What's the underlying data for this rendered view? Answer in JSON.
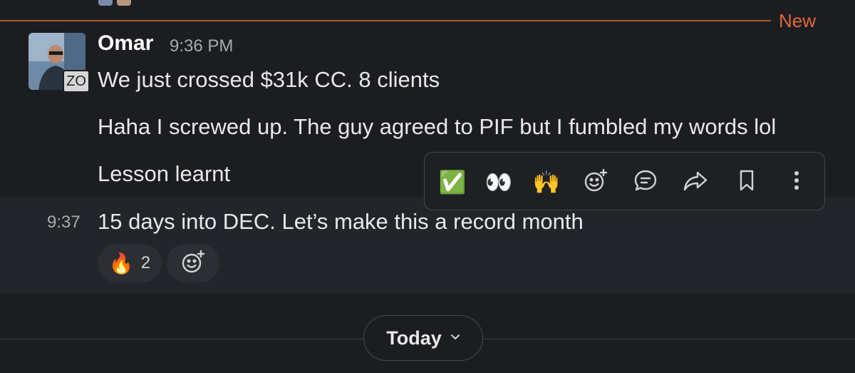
{
  "divider": {
    "label": "New"
  },
  "message_group": {
    "sender": "Omar",
    "time": "9:36 PM",
    "avatar_badge": "ZO",
    "messages": [
      "We just crossed $31k CC. 8 clients",
      "Haha I screwed up. The guy agreed to PIF but I fumbled my words lol",
      "Lesson learnt"
    ]
  },
  "hovered_message": {
    "time": "9:37",
    "text": "15 days into DEC. Let’s make this a record month",
    "reactions": [
      {
        "emoji": "🔥",
        "count": "2"
      }
    ]
  },
  "toolbar": {
    "items": [
      "white-check-mark-emoji",
      "eyes-emoji",
      "raised-hands-emoji",
      "add-reaction-icon",
      "reply-in-thread-icon",
      "share-icon",
      "save-bookmark-icon",
      "more-actions-icon"
    ],
    "emojis": {
      "check": "✅",
      "eyes": "👀",
      "hands": "🙌"
    }
  },
  "date_divider": {
    "label": "Today"
  },
  "colors": {
    "background": "#1b1d21",
    "new_divider": "#e0683b",
    "hover_background": "#222529"
  }
}
